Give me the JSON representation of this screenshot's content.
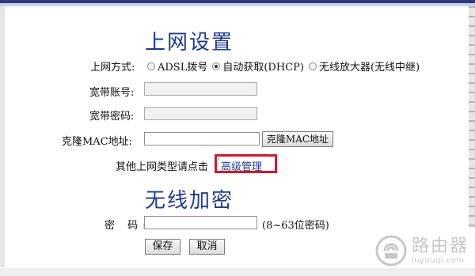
{
  "sections": {
    "internet_title": "上网设置",
    "wireless_title": "无线加密"
  },
  "wan": {
    "mode_label": "上网方式:",
    "options": [
      {
        "label": "ADSL拨号",
        "selected": false
      },
      {
        "label": "自动获取(DHCP)",
        "selected": true
      },
      {
        "label": "无线放大器(无线中继)",
        "selected": false
      }
    ],
    "user_label": "宽带账号:",
    "user_value": "",
    "pass_label": "宽带密码:",
    "pass_value": "",
    "mac_label": "克隆MAC地址:",
    "mac_value": "",
    "clone_button": "克隆MAC地址",
    "advanced_prefix": "其他上网类型请点击",
    "advanced_link": "高级管理"
  },
  "wireless": {
    "password_label": "密 码:",
    "password_value": "",
    "password_hint": "(8~63位密码)"
  },
  "actions": {
    "save": "保存",
    "cancel": "取消"
  },
  "watermark": {
    "cn": "路由器",
    "en": "luyouqi.com"
  },
  "colors": {
    "title_blue": "#1f3a92",
    "highlight_red": "#d11a2a"
  }
}
